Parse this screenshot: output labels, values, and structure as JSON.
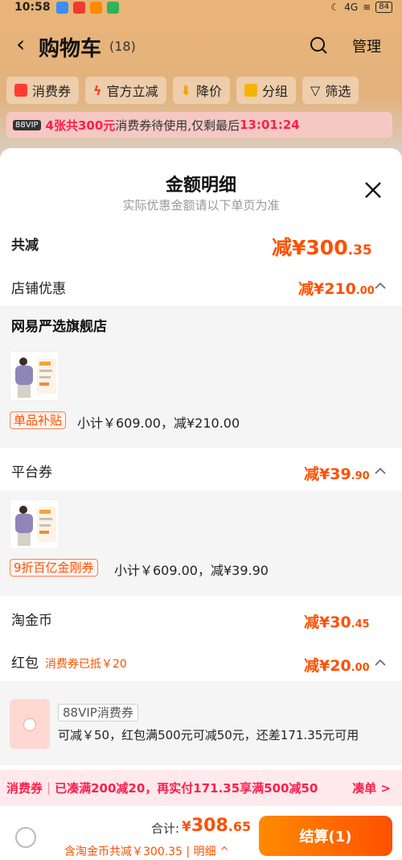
{
  "status_bar": {
    "time": "10:58",
    "network": "4G",
    "battery": "84"
  },
  "nav": {
    "title": "购物车",
    "count": "(18)",
    "manage": "管理"
  },
  "filters": [
    {
      "label": "消费券",
      "icon": "coupon-icon"
    },
    {
      "label": "官方立减",
      "icon": "lightning-icon"
    },
    {
      "label": "降价",
      "icon": "price-down-icon"
    },
    {
      "label": "分组",
      "icon": "folder-icon"
    },
    {
      "label": "筛选",
      "icon": "filter-icon"
    }
  ],
  "vip_banner": {
    "badge": "88VIP",
    "highlight": "4张共300元",
    "text": "消费券待使用,仅剩最后",
    "countdown": "13:01:24"
  },
  "sheet": {
    "title": "金额明细",
    "subtitle": "实际优惠金额请以下单页为准",
    "total": {
      "label": "共减",
      "prefix": "减¥",
      "int": "300",
      "dec": ".35"
    },
    "store_discount": {
      "label": "店铺优惠",
      "prefix": "减¥",
      "int": "210",
      "dec": ".00"
    },
    "store_name": "网易严选旗舰店",
    "store_item": {
      "tag": "单品补贴",
      "subtotal": "小计￥609.00，减¥210.00"
    },
    "platform": {
      "label": "平台券",
      "prefix": "减¥",
      "int": "39",
      "dec": ".90"
    },
    "platform_item": {
      "tag": "9折百亿金刚券",
      "subtotal": "小计￥609.00，减¥39.90"
    },
    "coins": {
      "label": "淘金币",
      "prefix": "减¥",
      "int": "30",
      "dec": ".45"
    },
    "redpacket": {
      "label": "红包",
      "note": "消费券已抵￥20",
      "prefix": "减¥",
      "int": "20",
      "dec": ".00"
    },
    "coupon": {
      "name": "88VIP消费券",
      "desc": "可减￥50，红包满500元可减50元，还差171.35元可用"
    }
  },
  "promo": {
    "title": "消费券",
    "text": "已凑满200减20，再实付171.35享满500减50",
    "action": "凑单 >"
  },
  "footer": {
    "total_label": "合计:",
    "total_prefix": "¥",
    "total_int": "308",
    "total_dec": ".65",
    "detail": "含淘金币共减￥300.35 | 明细",
    "checkout": "结算(1)"
  },
  "colors": {
    "accent": "#ff5000",
    "promo_red": "#ff1e4b"
  }
}
